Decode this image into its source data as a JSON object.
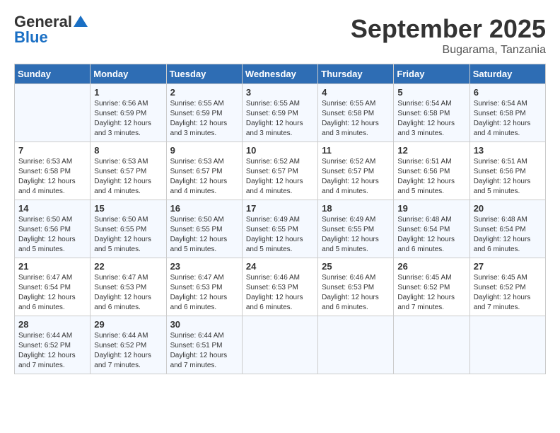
{
  "header": {
    "logo_general": "General",
    "logo_blue": "Blue",
    "month": "September 2025",
    "location": "Bugarama, Tanzania"
  },
  "days_of_week": [
    "Sunday",
    "Monday",
    "Tuesday",
    "Wednesday",
    "Thursday",
    "Friday",
    "Saturday"
  ],
  "weeks": [
    [
      {
        "day": "",
        "info": ""
      },
      {
        "day": "1",
        "info": "Sunrise: 6:56 AM\nSunset: 6:59 PM\nDaylight: 12 hours\nand 3 minutes."
      },
      {
        "day": "2",
        "info": "Sunrise: 6:55 AM\nSunset: 6:59 PM\nDaylight: 12 hours\nand 3 minutes."
      },
      {
        "day": "3",
        "info": "Sunrise: 6:55 AM\nSunset: 6:59 PM\nDaylight: 12 hours\nand 3 minutes."
      },
      {
        "day": "4",
        "info": "Sunrise: 6:55 AM\nSunset: 6:58 PM\nDaylight: 12 hours\nand 3 minutes."
      },
      {
        "day": "5",
        "info": "Sunrise: 6:54 AM\nSunset: 6:58 PM\nDaylight: 12 hours\nand 3 minutes."
      },
      {
        "day": "6",
        "info": "Sunrise: 6:54 AM\nSunset: 6:58 PM\nDaylight: 12 hours\nand 4 minutes."
      }
    ],
    [
      {
        "day": "7",
        "info": "Sunrise: 6:53 AM\nSunset: 6:58 PM\nDaylight: 12 hours\nand 4 minutes."
      },
      {
        "day": "8",
        "info": "Sunrise: 6:53 AM\nSunset: 6:57 PM\nDaylight: 12 hours\nand 4 minutes."
      },
      {
        "day": "9",
        "info": "Sunrise: 6:53 AM\nSunset: 6:57 PM\nDaylight: 12 hours\nand 4 minutes."
      },
      {
        "day": "10",
        "info": "Sunrise: 6:52 AM\nSunset: 6:57 PM\nDaylight: 12 hours\nand 4 minutes."
      },
      {
        "day": "11",
        "info": "Sunrise: 6:52 AM\nSunset: 6:57 PM\nDaylight: 12 hours\nand 4 minutes."
      },
      {
        "day": "12",
        "info": "Sunrise: 6:51 AM\nSunset: 6:56 PM\nDaylight: 12 hours\nand 5 minutes."
      },
      {
        "day": "13",
        "info": "Sunrise: 6:51 AM\nSunset: 6:56 PM\nDaylight: 12 hours\nand 5 minutes."
      }
    ],
    [
      {
        "day": "14",
        "info": "Sunrise: 6:50 AM\nSunset: 6:56 PM\nDaylight: 12 hours\nand 5 minutes."
      },
      {
        "day": "15",
        "info": "Sunrise: 6:50 AM\nSunset: 6:55 PM\nDaylight: 12 hours\nand 5 minutes."
      },
      {
        "day": "16",
        "info": "Sunrise: 6:50 AM\nSunset: 6:55 PM\nDaylight: 12 hours\nand 5 minutes."
      },
      {
        "day": "17",
        "info": "Sunrise: 6:49 AM\nSunset: 6:55 PM\nDaylight: 12 hours\nand 5 minutes."
      },
      {
        "day": "18",
        "info": "Sunrise: 6:49 AM\nSunset: 6:55 PM\nDaylight: 12 hours\nand 5 minutes."
      },
      {
        "day": "19",
        "info": "Sunrise: 6:48 AM\nSunset: 6:54 PM\nDaylight: 12 hours\nand 6 minutes."
      },
      {
        "day": "20",
        "info": "Sunrise: 6:48 AM\nSunset: 6:54 PM\nDaylight: 12 hours\nand 6 minutes."
      }
    ],
    [
      {
        "day": "21",
        "info": "Sunrise: 6:47 AM\nSunset: 6:54 PM\nDaylight: 12 hours\nand 6 minutes."
      },
      {
        "day": "22",
        "info": "Sunrise: 6:47 AM\nSunset: 6:53 PM\nDaylight: 12 hours\nand 6 minutes."
      },
      {
        "day": "23",
        "info": "Sunrise: 6:47 AM\nSunset: 6:53 PM\nDaylight: 12 hours\nand 6 minutes."
      },
      {
        "day": "24",
        "info": "Sunrise: 6:46 AM\nSunset: 6:53 PM\nDaylight: 12 hours\nand 6 minutes."
      },
      {
        "day": "25",
        "info": "Sunrise: 6:46 AM\nSunset: 6:53 PM\nDaylight: 12 hours\nand 6 minutes."
      },
      {
        "day": "26",
        "info": "Sunrise: 6:45 AM\nSunset: 6:52 PM\nDaylight: 12 hours\nand 7 minutes."
      },
      {
        "day": "27",
        "info": "Sunrise: 6:45 AM\nSunset: 6:52 PM\nDaylight: 12 hours\nand 7 minutes."
      }
    ],
    [
      {
        "day": "28",
        "info": "Sunrise: 6:44 AM\nSunset: 6:52 PM\nDaylight: 12 hours\nand 7 minutes."
      },
      {
        "day": "29",
        "info": "Sunrise: 6:44 AM\nSunset: 6:52 PM\nDaylight: 12 hours\nand 7 minutes."
      },
      {
        "day": "30",
        "info": "Sunrise: 6:44 AM\nSunset: 6:51 PM\nDaylight: 12 hours\nand 7 minutes."
      },
      {
        "day": "",
        "info": ""
      },
      {
        "day": "",
        "info": ""
      },
      {
        "day": "",
        "info": ""
      },
      {
        "day": "",
        "info": ""
      }
    ]
  ]
}
